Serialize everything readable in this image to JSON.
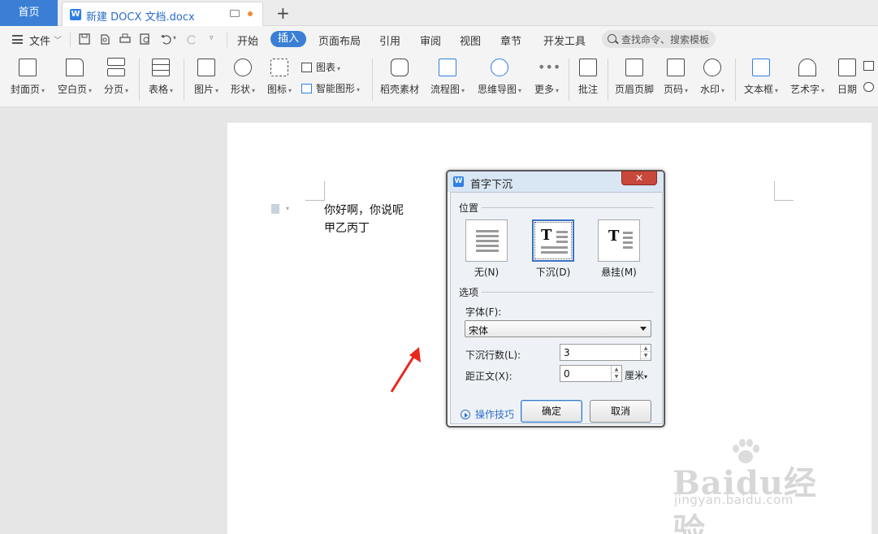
{
  "titlebar": {
    "home_tab": "首页",
    "doc_tab": "新建 DOCX 文档.docx",
    "new_tab_symbol": "+"
  },
  "menubar": {
    "file": "文件",
    "tabs": [
      "开始",
      "插入",
      "页面布局",
      "引用",
      "审阅",
      "视图",
      "章节",
      "开发工具"
    ],
    "active_tab": "插入",
    "search_placeholder": "查找命令、搜索模板"
  },
  "ribbon": {
    "cover_page": "封面页",
    "blank_page": "空白页",
    "page_break": "分页",
    "table": "表格",
    "picture": "图片",
    "shape": "形状",
    "icon": "图标",
    "chart": "图表",
    "smart_art": "智能图形",
    "material": "稻壳素材",
    "flowchart": "流程图",
    "mindmap": "思维导图",
    "more": "更多",
    "comment": "批注",
    "header_footer": "页眉页脚",
    "page_number": "页码",
    "watermark": "水印",
    "textbox": "文本框",
    "wordart": "艺术字",
    "date": "日期"
  },
  "document": {
    "line1": "你好啊，你说呢",
    "line2": "甲乙丙丁"
  },
  "dialog": {
    "title": "首字下沉",
    "close_symbol": "✕",
    "position_section": "位置",
    "position_none": "无(N)",
    "position_drop": "下沉(D)",
    "position_margin": "悬挂(M)",
    "selected_position": "下沉(D)",
    "options_section": "选项",
    "font_label": "字体(F):",
    "font_value": "宋体",
    "lines_label": "下沉行数(L):",
    "lines_value": "3",
    "distance_label": "距正文(X):",
    "distance_value": "0",
    "distance_unit": "厘米",
    "tips": "操作技巧",
    "ok": "确定",
    "cancel": "取消"
  },
  "watermark": {
    "brand": "Baidu经验",
    "url": "jingyan.baidu.com"
  },
  "colors": {
    "accent": "#3a7fd5",
    "dialog_title_bg": "#d9e6f4",
    "close_button": "#c9483c",
    "annotation_arrow": "#e8281d"
  }
}
